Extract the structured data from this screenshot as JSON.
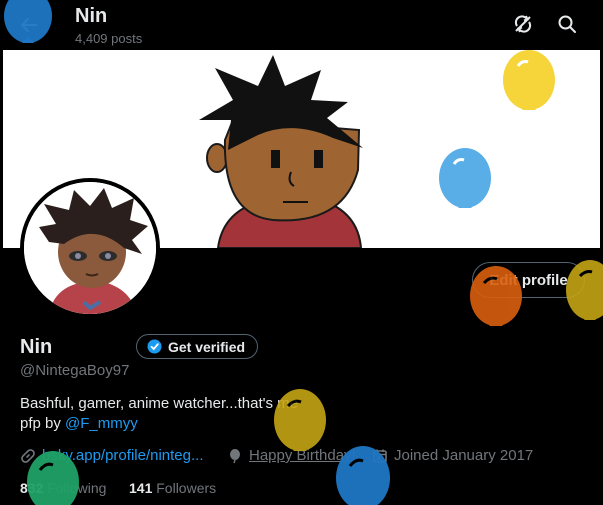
{
  "header": {
    "title": "Nin",
    "post_count": "4,409 posts"
  },
  "profile": {
    "name": "Nin",
    "verify_label": "Get verified",
    "handle": "@NintegaBoy97",
    "bio_text": "Bashful, gamer, anime watcher...that's me",
    "bio_credit_prefix": "pfp by",
    "bio_credit_link": "@F_mmyy",
    "edit_label": "Edit profile",
    "website": "bsky.app/profile/ninteg...",
    "birthday": "Happy Birthday!",
    "joined": "Joined January 2017",
    "following_count": "832",
    "following_label": "Following",
    "followers_count": "141",
    "followers_label": "Followers"
  },
  "colors": {
    "accent": "#1d9bf0",
    "muted": "#71767b",
    "text": "#e7e9ea",
    "balloon_yellow": "#f5d53a",
    "balloon_blue": "#5aaee8",
    "balloon_orange": "#d95f0e",
    "balloon_dark_blue": "#1f77c4",
    "balloon_green": "#1fa267",
    "balloon_olive": "#c4a514"
  },
  "icons": {
    "back": "arrow-left-icon",
    "sync": "sync-off-icon",
    "search": "search-icon",
    "verified": "verified-badge-icon",
    "link": "link-icon",
    "balloon": "balloon-icon",
    "calendar": "calendar-icon"
  }
}
